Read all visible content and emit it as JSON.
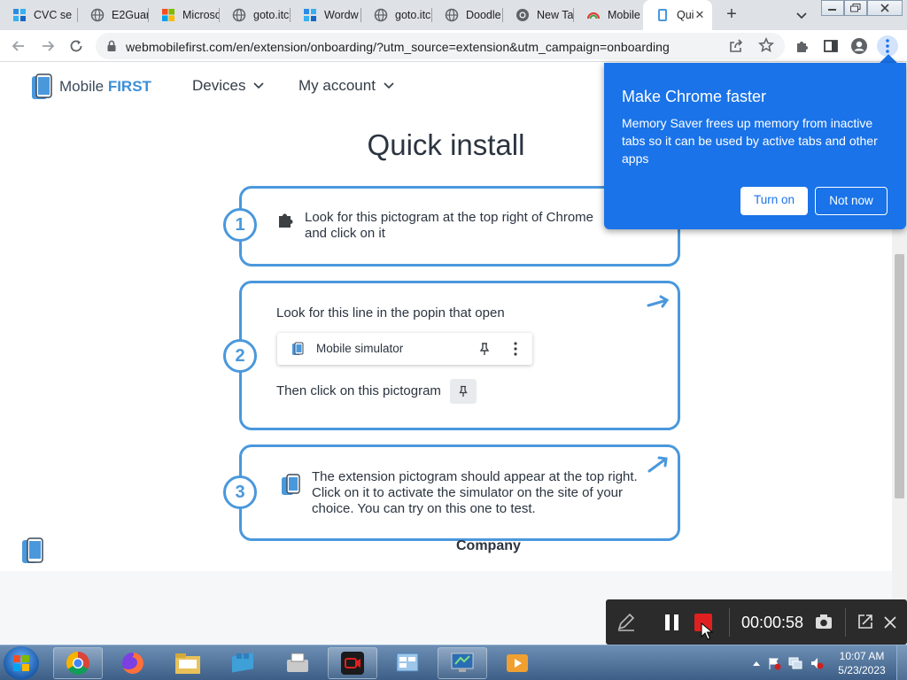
{
  "browser": {
    "tabs": [
      {
        "title": "CVC se",
        "favicon": "grid-logo-icon"
      },
      {
        "title": "E2Guar",
        "favicon": "globe-icon"
      },
      {
        "title": "Microsc",
        "favicon": "microsoft-logo-icon"
      },
      {
        "title": "goto.itc",
        "favicon": "globe-icon"
      },
      {
        "title": "Wordw",
        "favicon": "grid-logo-icon"
      },
      {
        "title": "goto.itc",
        "favicon": "globe-icon"
      },
      {
        "title": "Doodle",
        "favicon": "globe-icon"
      },
      {
        "title": "New Ta",
        "favicon": "chrome-icon"
      },
      {
        "title": "Mobile",
        "favicon": "rainbow-icon"
      },
      {
        "title": "Qui",
        "favicon": "phone-icon",
        "active": true
      }
    ],
    "url": "webmobilefirst.com/en/extension/onboarding/?utm_source=extension&utm_campaign=onboarding"
  },
  "site": {
    "brand_name": "Mobile",
    "brand_highlight": "FIRST",
    "nav": [
      {
        "label": "Devices"
      },
      {
        "label": "My account"
      }
    ],
    "heading": "Quick install",
    "steps": [
      {
        "number": "1",
        "text": "Look for this pictogram at the top right of Chrome and click on it"
      },
      {
        "number": "2",
        "text": "Look for this line in the popin that open",
        "popin_label": "Mobile simulator",
        "then_text": "Then click on this pictogram"
      },
      {
        "number": "3",
        "text": "The extension pictogram should appear at the top right. Click on it to activate the simulator on the site of your choice. You can try on this one to test."
      }
    ],
    "footer": {
      "company_label": "Company"
    }
  },
  "bubble": {
    "title": "Make Chrome faster",
    "text": "Memory Saver frees up memory from inactive tabs so it can be used by active tabs and other apps",
    "turn_on_label": "Turn on",
    "not_now_label": "Not now"
  },
  "recorder": {
    "time": "00:00:58"
  },
  "taskbar": {
    "time": "10:07 AM",
    "date": "5/23/2023"
  },
  "colors": {
    "accent": "#4a98dc",
    "chrome_blue": "#1a73e8"
  }
}
